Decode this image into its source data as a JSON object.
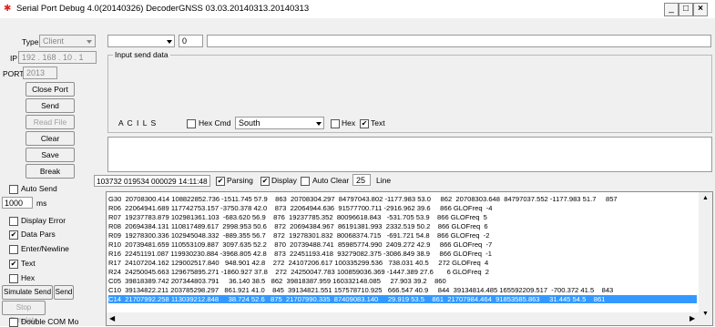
{
  "window": {
    "title": "Serial Port Debug 4.0(20140326) DecoderGNSS  03.03.20140313.20140313",
    "min": "_",
    "max": "□",
    "close": "×"
  },
  "left": {
    "type_label": "Type",
    "type_value": "Client",
    "ip_label": "IP",
    "ip_value": "192 . 168 . 10 . 1",
    "port_label": "PORT",
    "port_value": "2013",
    "buttons": {
      "close_port": "Close Port",
      "send": "Send",
      "read_file": "Read File",
      "clear": "Clear",
      "save": "Save",
      "break": "Break"
    },
    "auto_send": "Auto Send",
    "interval_value": "1000",
    "interval_unit": "ms",
    "display_error": "Display Error",
    "data_pars": "Data Pars",
    "enter_newline": "Enter/Newline",
    "text": "Text",
    "hex": "Hex",
    "simulate_send": "Simulate Send",
    "send_short": "Send",
    "stop_simulate": "Stop Simulate",
    "double_com": "Double COM Mo"
  },
  "input": {
    "combo_value": "",
    "num_value": "0",
    "wide_value": "",
    "group_label": "Input send data",
    "acils": "A C I L S",
    "hex_cmd": "Hex Cmd",
    "direction_value": "South",
    "hex": "Hex",
    "text": "Text"
  },
  "statusrow": {
    "timestamp": "103732 019534 000029 14:11:48",
    "parsing": "Parsing",
    "display": "Display",
    "auto_clear": "Auto Clear",
    "auto_clear_value": "25",
    "line": "Line"
  },
  "log": {
    "lines": [
      "G30  20708300.414 108822852.736 -1511.745 57.9    863  20708304.297  84797043.802 -1177.983 53.0     862  20708303.648  84797037.552 -1177.983 51.7     857",
      "R06  22064941.689 117742753.157 -3750.378 42.0    873  22064944.636  91577700.711 -2916.962 39.6     866 GLOFreq  -4",
      "R07  19237783.879 102981361.103  -683.620 56.9    876  19237785.352  80096618.843   -531.705 53.9    866 GLOFreq  5",
      "R08  20694384.131 110817489.617  2998.953 50.6    872  20694384.967  86191381.993  2332.519 50.2    866 GLOFreq  6",
      "R09  19278300.336 102945048.332  -889.355 56.7    872  19278301.832  80068374.715   -691.721 54.8    866 GLOFreq  -2",
      "R10  20739481.659 110553109.887  3097.635 52.2    870  20739488.741  85985774.990  2409.272 42.9     866 GLOFreq  -7",
      "R16  22451191.087 119930230.884 -3968.805 42.8    873  22451193.418  93279082.375 -3086.849 38.9     866 GLOFreq  -1",
      "R17  24107204.162 129002517.840   948.901 42.8    272  24107206.617 100335299.536   738.031 40.5     272 GLOFreq  4",
      "R24  24250045.663 129675895.271 -1860.927 37.8    272  24250047.783 100859036.369 -1447.389 27.6       6 GLOFreq  2",
      "C05  39818389.742 207344803.791     36.140 38.5   862  39818387.959 160332148.085     27.903 39.2    860",
      "C10  39134822.211 203785298.297   861.921 41.0    845  39134821.551 157578710.925   666.547 40.9     844  39134814.485 165592209.517  -700.372 41.5    843",
      "C14  21707992.258 113039212.848     38.724 52.6   875  21707990.335  87409083.140     29.919 53.5    861  21707984.464  91853585.863     31.445 54.5    861"
    ],
    "selected_index": 11
  },
  "colors": {
    "selection": "#3399ff",
    "background": "#f0f0f0",
    "app_icon": "#d22222"
  }
}
